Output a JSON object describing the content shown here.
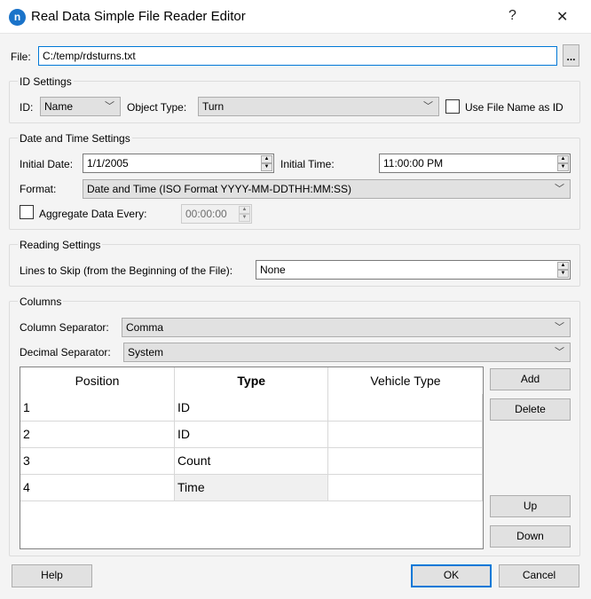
{
  "window": {
    "title": "Real Data Simple File Reader Editor",
    "icon_letter": "n",
    "help": "?",
    "close": "✕"
  },
  "file": {
    "label": "File:",
    "value": "C:/temp/rdsturns.txt",
    "browse": "..."
  },
  "id_settings": {
    "title": "ID Settings",
    "id_label": "ID:",
    "id_value": "Name",
    "object_type_label": "Object Type:",
    "object_type_value": "Turn",
    "use_file_name_label": "Use File Name as ID",
    "use_file_name_checked": false
  },
  "date_time": {
    "title": "Date and Time Settings",
    "initial_date_label": "Initial Date:",
    "initial_date": "1/1/2005",
    "initial_time_label": "Initial Time:",
    "initial_time": "11:00:00 PM",
    "format_label": "Format:",
    "format_value": "Date and Time (ISO Format YYYY-MM-DDTHH:MM:SS)",
    "aggregate_label": "Aggregate Data Every:",
    "aggregate_checked": false,
    "aggregate_value": "00:00:00"
  },
  "reading": {
    "title": "Reading Settings",
    "lines_label": "Lines to Skip (from the Beginning of the File):",
    "lines_value": "None"
  },
  "columns": {
    "title": "Columns",
    "column_sep_label": "Column Separator:",
    "column_sep_value": "Comma",
    "decimal_sep_label": "Decimal Separator:",
    "decimal_sep_value": "System",
    "headers": [
      "Position",
      "Type",
      "Vehicle Type"
    ],
    "rows": [
      [
        "1",
        "ID",
        ""
      ],
      [
        "2",
        "ID",
        ""
      ],
      [
        "3",
        "Count",
        ""
      ],
      [
        "4",
        "Time",
        ""
      ]
    ],
    "add": "Add",
    "delete": "Delete",
    "up": "Up",
    "down": "Down"
  },
  "footer": {
    "help": "Help",
    "ok": "OK",
    "cancel": "Cancel"
  },
  "colors": {
    "accent": "#0078d7",
    "icon": "#1a73c9"
  }
}
